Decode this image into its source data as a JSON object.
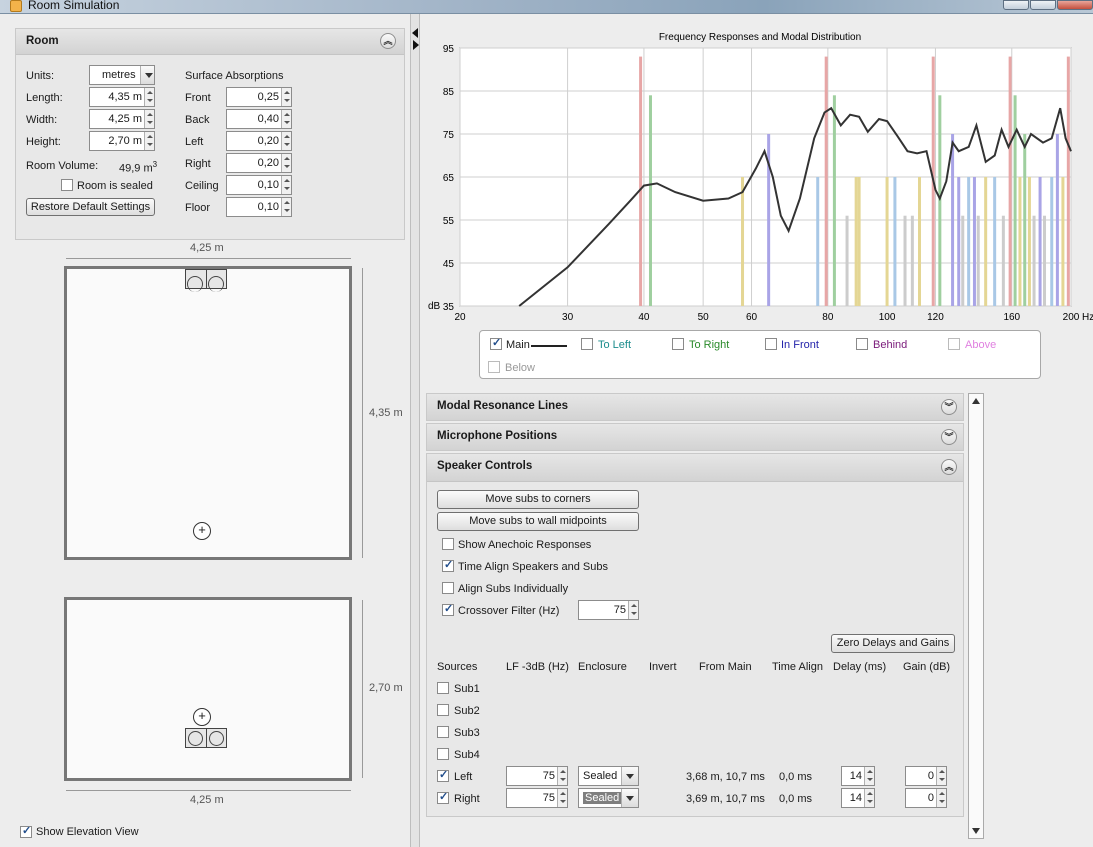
{
  "window": {
    "title": "Room Simulation"
  },
  "room_panel": {
    "title": "Room",
    "units_label": "Units:",
    "units_value": "metres",
    "length_label": "Length:",
    "length_value": "4,35 m",
    "width_label": "Width:",
    "width_value": "4,25 m",
    "height_label": "Height:",
    "height_value": "2,70 m",
    "volume_label": "Room Volume:",
    "volume_value": "49,9 m",
    "volume_sup": "3",
    "sealed_label": "Room is sealed",
    "sealed_checked": false,
    "restore_button": "Restore Default Settings",
    "surface_title": "Surface Absorptions",
    "surfaces": [
      {
        "label": "Front",
        "value": "0,25"
      },
      {
        "label": "Back",
        "value": "0,40"
      },
      {
        "label": "Left",
        "value": "0,20"
      },
      {
        "label": "Right",
        "value": "0,20"
      },
      {
        "label": "Ceiling",
        "value": "0,10"
      },
      {
        "label": "Floor",
        "value": "0,10"
      }
    ]
  },
  "plan_view": {
    "top_dim": "4,25 m",
    "side_dim": "4,35 m"
  },
  "elevation_view": {
    "side_dim": "2,70 m",
    "bottom_dim": "4,25 m"
  },
  "show_elevation": {
    "label": "Show Elevation View",
    "checked": true
  },
  "chart_data": {
    "type": "line",
    "title": "Frequency Responses and Modal Distribution",
    "xlabel": "Hz",
    "ylabel": "dB",
    "x_scale": "log",
    "xlim": [
      20,
      200
    ],
    "ylim": [
      35,
      95
    ],
    "x_ticks": [
      "20",
      "30",
      "40",
      "50",
      "60",
      "80",
      "100",
      "120",
      "160",
      "200"
    ],
    "x_tick_values": [
      20,
      30,
      40,
      50,
      60,
      80,
      100,
      120,
      160,
      200
    ],
    "y_ticks": [
      "35",
      "45",
      "55",
      "65",
      "75",
      "85",
      "95"
    ],
    "y_tick_values": [
      35,
      45,
      55,
      65,
      75,
      85,
      95
    ],
    "grid": true,
    "series": [
      {
        "name": "Main",
        "color": "#333333",
        "points": [
          [
            25,
            35
          ],
          [
            30,
            44
          ],
          [
            35,
            54
          ],
          [
            38,
            59.5
          ],
          [
            40,
            63
          ],
          [
            42,
            63.5
          ],
          [
            45,
            61.5
          ],
          [
            50,
            59.5
          ],
          [
            55,
            60
          ],
          [
            58,
            61.5
          ],
          [
            61,
            67
          ],
          [
            63,
            71
          ],
          [
            65,
            65
          ],
          [
            67,
            56
          ],
          [
            69,
            52.5
          ],
          [
            72,
            60
          ],
          [
            76,
            74
          ],
          [
            79,
            80
          ],
          [
            81,
            81
          ],
          [
            84,
            77
          ],
          [
            87,
            79.5
          ],
          [
            90,
            79
          ],
          [
            93,
            75.5
          ],
          [
            97,
            78.5
          ],
          [
            100,
            78
          ],
          [
            104,
            74.5
          ],
          [
            108,
            71
          ],
          [
            112,
            70.5
          ],
          [
            116,
            71
          ],
          [
            120,
            62
          ],
          [
            122,
            60
          ],
          [
            125,
            64
          ],
          [
            128,
            73
          ],
          [
            131,
            71
          ],
          [
            136,
            72
          ],
          [
            140,
            77
          ],
          [
            145,
            68.5
          ],
          [
            150,
            70
          ],
          [
            154,
            76
          ],
          [
            158,
            72
          ],
          [
            163,
            76
          ],
          [
            168,
            72
          ],
          [
            172,
            75
          ],
          [
            180,
            73
          ],
          [
            186,
            74
          ],
          [
            192,
            81
          ],
          [
            196,
            74
          ],
          [
            200,
            71
          ]
        ]
      }
    ],
    "modal_lines": [
      {
        "hz": 39.5,
        "db": 93,
        "color": "#e7a6a6"
      },
      {
        "hz": 41,
        "db": 84,
        "color": "#9fcf9f"
      },
      {
        "hz": 58,
        "db": 65,
        "color": "#e4d694"
      },
      {
        "hz": 64,
        "db": 75,
        "color": "#a9a4e6"
      },
      {
        "hz": 77,
        "db": 65,
        "color": "#a9c8e6"
      },
      {
        "hz": 79.5,
        "db": 93,
        "color": "#e7a6a6"
      },
      {
        "hz": 82,
        "db": 84,
        "color": "#9fcf9f"
      },
      {
        "hz": 86,
        "db": 56,
        "color": "#cccccc"
      },
      {
        "hz": 89,
        "db": 65,
        "color": "#e4d694"
      },
      {
        "hz": 90,
        "db": 65,
        "color": "#e4d694"
      },
      {
        "hz": 100,
        "db": 65,
        "color": "#e4d694"
      },
      {
        "hz": 103,
        "db": 65,
        "color": "#a9c8e6"
      },
      {
        "hz": 107,
        "db": 56,
        "color": "#cccccc"
      },
      {
        "hz": 110,
        "db": 56,
        "color": "#cccccc"
      },
      {
        "hz": 113,
        "db": 65,
        "color": "#e4d694"
      },
      {
        "hz": 119,
        "db": 93,
        "color": "#e7a6a6"
      },
      {
        "hz": 122,
        "db": 84,
        "color": "#9fcf9f"
      },
      {
        "hz": 128,
        "db": 75,
        "color": "#a9a4e6"
      },
      {
        "hz": 131,
        "db": 65,
        "color": "#a9a4e6"
      },
      {
        "hz": 133,
        "db": 56,
        "color": "#cccccc"
      },
      {
        "hz": 136,
        "db": 65,
        "color": "#a9c8e6"
      },
      {
        "hz": 139,
        "db": 65,
        "color": "#a9a4e6"
      },
      {
        "hz": 141,
        "db": 56,
        "color": "#cccccc"
      },
      {
        "hz": 145,
        "db": 65,
        "color": "#e4d694"
      },
      {
        "hz": 150,
        "db": 65,
        "color": "#a9c8e6"
      },
      {
        "hz": 155,
        "db": 56,
        "color": "#cccccc"
      },
      {
        "hz": 159,
        "db": 93,
        "color": "#e7a6a6"
      },
      {
        "hz": 162,
        "db": 84,
        "color": "#9fcf9f"
      },
      {
        "hz": 165,
        "db": 65,
        "color": "#e4d694"
      },
      {
        "hz": 168,
        "db": 75,
        "color": "#9fcf9f"
      },
      {
        "hz": 171,
        "db": 65,
        "color": "#e4d694"
      },
      {
        "hz": 174,
        "db": 56,
        "color": "#cccccc"
      },
      {
        "hz": 178,
        "db": 65,
        "color": "#a9a4e6"
      },
      {
        "hz": 181,
        "db": 56,
        "color": "#cccccc"
      },
      {
        "hz": 186,
        "db": 65,
        "color": "#a9c8e6"
      },
      {
        "hz": 190,
        "db": 75,
        "color": "#a9a4e6"
      },
      {
        "hz": 194,
        "db": 65,
        "color": "#e4d694"
      },
      {
        "hz": 198,
        "db": 93,
        "color": "#e7a6a6"
      }
    ]
  },
  "legend": {
    "items": [
      {
        "label": "Main",
        "checked": true,
        "color": "#222222"
      },
      {
        "label": "To Left",
        "checked": false,
        "color": "#1a8c8c"
      },
      {
        "label": "To Right",
        "checked": false,
        "color": "#2a8a2a"
      },
      {
        "label": "In Front",
        "checked": false,
        "color": "#2222aa"
      },
      {
        "label": "Behind",
        "checked": false,
        "color": "#7a1a7a"
      },
      {
        "label": "Above",
        "checked": false,
        "color": "#e080e0"
      },
      {
        "label": "Below",
        "checked": false,
        "color": "#999999"
      }
    ]
  },
  "sections": {
    "modal": "Modal Resonance Lines",
    "mic": "Microphone Positions",
    "speaker": "Speaker Controls"
  },
  "speaker_controls": {
    "move_corners": "Move subs to corners",
    "move_midpoints": "Move subs to wall midpoints",
    "show_anechoic": {
      "label": "Show Anechoic Responses",
      "checked": false
    },
    "time_align": {
      "label": "Time Align Speakers and Subs",
      "checked": true
    },
    "align_subs": {
      "label": "Align Subs Individually",
      "checked": false
    },
    "crossover": {
      "label": "Crossover Filter (Hz)",
      "checked": true,
      "value": "75"
    },
    "zero_button": "Zero Delays and Gains",
    "columns": [
      "Sources",
      "LF -3dB (Hz)",
      "Enclosure",
      "Invert",
      "From Main",
      "Time Align",
      "Delay (ms)",
      "Gain (dB)"
    ],
    "sources": [
      {
        "name": "Sub1",
        "checked": false
      },
      {
        "name": "Sub2",
        "checked": false
      },
      {
        "name": "Sub3",
        "checked": false
      },
      {
        "name": "Sub4",
        "checked": false
      },
      {
        "name": "Left",
        "checked": true,
        "lf": "75",
        "enclosure": "Sealed",
        "from_main": "3,68 m, 10,7 ms",
        "time_align": "0,0 ms",
        "delay": "14",
        "gain": "0"
      },
      {
        "name": "Right",
        "checked": true,
        "lf": "75",
        "enclosure": "Sealed",
        "from_main": "3,69 m, 10,7 ms",
        "time_align": "0,0 ms",
        "delay": "14",
        "gain": "0"
      }
    ]
  }
}
